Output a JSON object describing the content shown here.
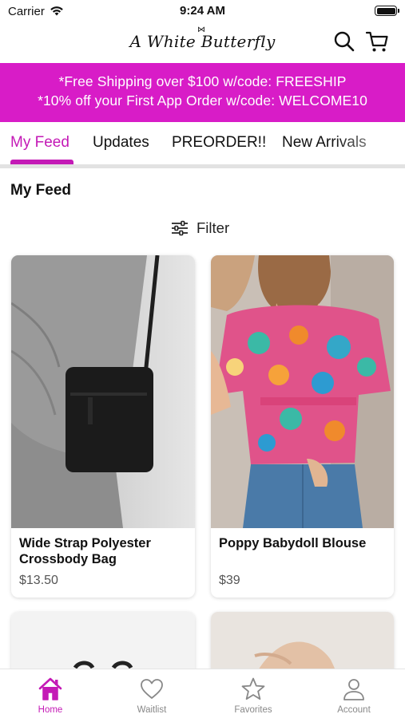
{
  "status_bar": {
    "carrier": "Carrier",
    "time": "9:24 AM"
  },
  "header": {
    "logo_text": "A White Butterfly",
    "search_icon": "search-icon",
    "cart_icon": "cart-icon"
  },
  "banner": {
    "line1": "*Free Shipping over $100 w/code: FREESHIP",
    "line2": "*10% off your First App Order w/code: WELCOME10",
    "background": "#d81cc7"
  },
  "tabs": [
    {
      "label": "My Feed",
      "active": true
    },
    {
      "label": "Updates",
      "active": false
    },
    {
      "label": "PREORDER!!",
      "active": false
    },
    {
      "label": "New Arrivals",
      "active": false
    }
  ],
  "accent_color": "#c41ab6",
  "feed": {
    "title": "My Feed",
    "filter_label": "Filter",
    "products": [
      {
        "name": "Wide Strap Polyester Crossbody Bag",
        "price": "$13.50"
      },
      {
        "name": "Poppy Babydoll Blouse",
        "price": "$39"
      }
    ]
  },
  "bottom_nav": [
    {
      "label": "Home",
      "icon": "home-icon",
      "active": true
    },
    {
      "label": "Waitlist",
      "icon": "heart-icon",
      "active": false
    },
    {
      "label": "Favorites",
      "icon": "star-icon",
      "active": false
    },
    {
      "label": "Account",
      "icon": "person-icon",
      "active": false
    }
  ]
}
